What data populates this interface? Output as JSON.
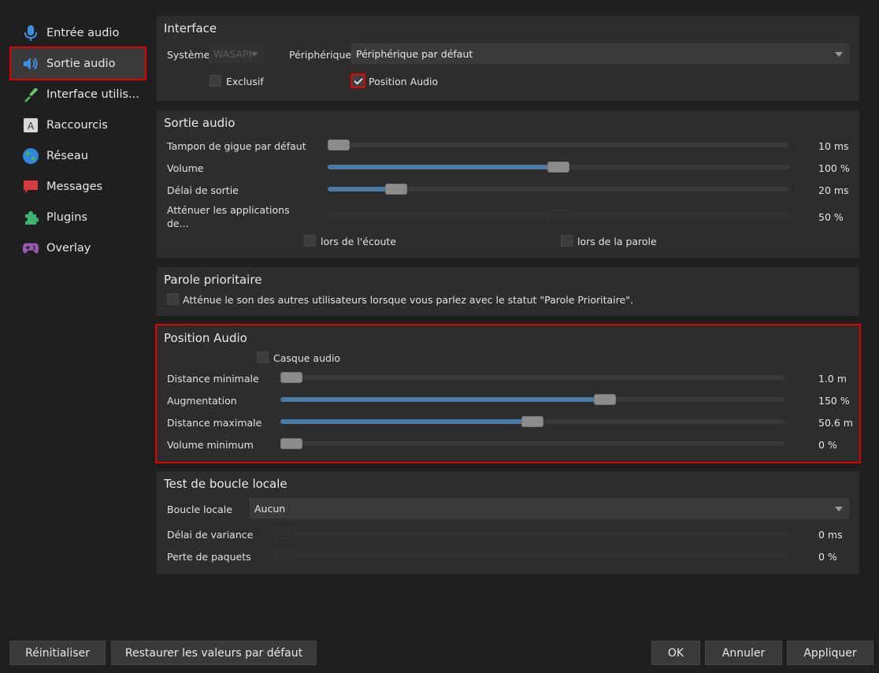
{
  "sidebar": {
    "items": [
      {
        "label": "Entrée audio",
        "icon": "microphone-icon"
      },
      {
        "label": "Sortie audio",
        "icon": "speaker-icon"
      },
      {
        "label": "Interface utilis...",
        "icon": "brush-icon"
      },
      {
        "label": "Raccourcis",
        "icon": "keyboard-key-icon"
      },
      {
        "label": "Réseau",
        "icon": "globe-icon"
      },
      {
        "label": "Messages",
        "icon": "speech-bubble-icon"
      },
      {
        "label": "Plugins",
        "icon": "puzzle-icon"
      },
      {
        "label": "Overlay",
        "icon": "gamepad-icon"
      }
    ],
    "selected": "Sortie audio"
  },
  "interface": {
    "title": "Interface",
    "system_label": "Système",
    "system_value": "WASAPI",
    "device_label": "Périphérique",
    "device_value": "Périphérique par défaut",
    "exclusive_label": "Exclusif",
    "exclusive_checked": false,
    "position_audio_label": "Position Audio",
    "position_audio_checked": true
  },
  "audio_output": {
    "title": "Sortie audio",
    "jitter_label": "Tampon de gigue par défaut",
    "jitter_value": "10 ms",
    "jitter_level": 0.0,
    "volume_label": "Volume",
    "volume_value": "100 %",
    "volume_level": 0.5,
    "delay_label": "Délai de sortie",
    "delay_value": "20 ms",
    "delay_level": 0.13,
    "attenuate_label_1": "Atténuer les applications",
    "attenuate_label_2": "de...",
    "attenuate_value": "50 %",
    "attenuate_level": 0.5,
    "while_listening_label": "lors de l'écoute",
    "while_speaking_label": "lors de la parole"
  },
  "priority_speaker": {
    "title": "Parole prioritaire",
    "checkbox_label": "Atténue le son des autres utilisateurs lorsque vous parlez avec le statut \"Parole Prioritaire\"."
  },
  "positional_audio": {
    "title": "Position Audio",
    "headphones_label": "Casque audio",
    "min_distance_label": "Distance minimale",
    "min_distance_value": "1.0 m",
    "min_distance_level": 0.0,
    "bloom_label": "Augmentation",
    "bloom_value": "150 %",
    "bloom_level": 0.65,
    "max_distance_label": "Distance maximale",
    "max_distance_value": "50.6 m",
    "max_distance_level": 0.5,
    "min_volume_label": "Volume minimum",
    "min_volume_value": "0 %",
    "min_volume_level": 0.0
  },
  "loopback": {
    "title": "Test de boucle locale",
    "loopback_label": "Boucle locale",
    "loopback_value": "Aucun",
    "variance_label": "Délai de variance",
    "variance_value": "0 ms",
    "packet_loss_label": "Perte de paquets",
    "packet_loss_value": "0 %"
  },
  "buttons": {
    "reset": "Réinitialiser",
    "restore": "Restaurer les valeurs par défaut",
    "ok": "OK",
    "cancel": "Annuler",
    "apply": "Appliquer"
  },
  "colors": {
    "accent": "#4a7aa4",
    "highlight_red": "#e00000"
  }
}
